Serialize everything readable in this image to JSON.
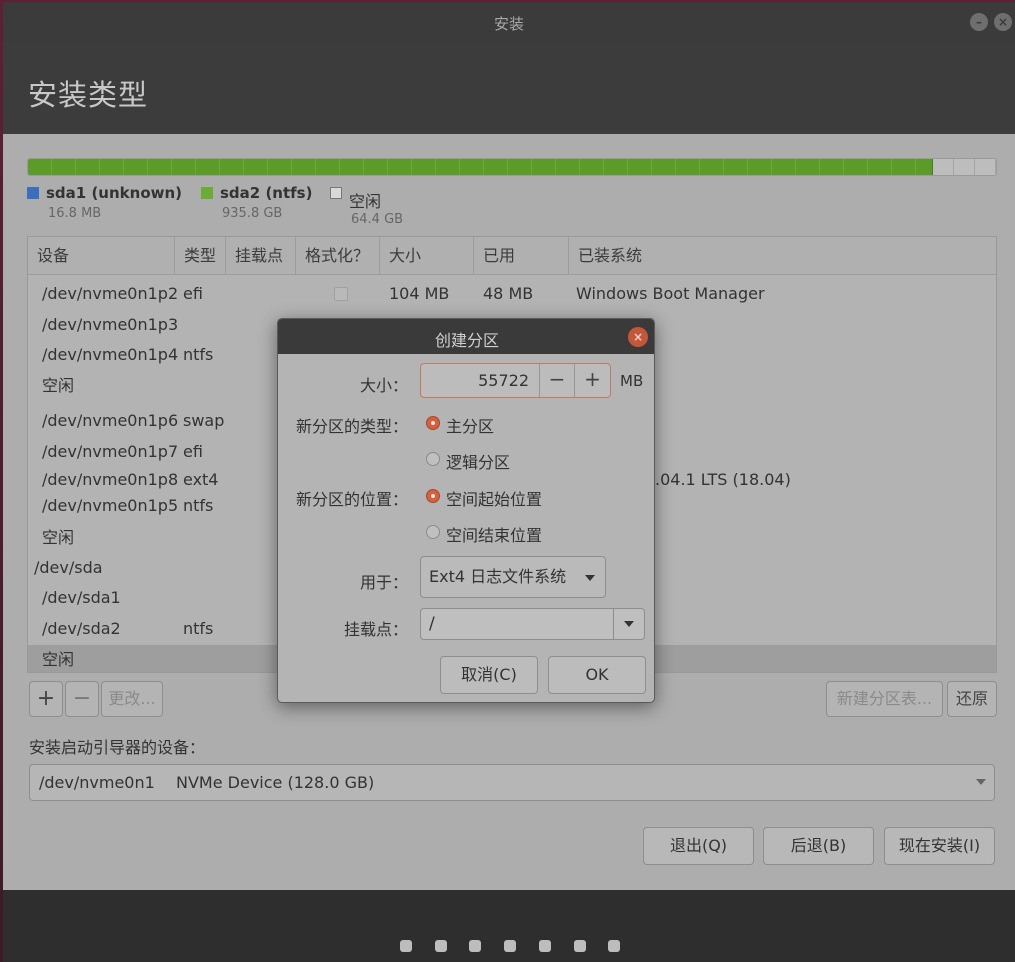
{
  "window": {
    "title": "安装"
  },
  "page": {
    "title": "安装类型"
  },
  "disk_bar": {
    "used_fraction": 0.935,
    "colors": {
      "sda1": "#3a6fc0",
      "sda2": "#6cab36",
      "free": "#bdbdbd"
    }
  },
  "legend": [
    {
      "name": "sda1 (unknown)",
      "size": "16.8 MB",
      "color": "#3a6fc0"
    },
    {
      "name": "sda2 (ntfs)",
      "size": "935.8 GB",
      "color": "#6cab36"
    },
    {
      "name": "空闲",
      "size": "64.4 GB",
      "color": "#d8d8d8"
    }
  ],
  "table": {
    "columns": [
      "设备",
      "类型",
      "挂载点",
      "格式化？",
      "大小",
      "已用",
      "已装系统"
    ],
    "rows": [
      {
        "device": "/dev/nvme0n1p2",
        "type": "efi",
        "size": "104 MB",
        "used": "48 MB",
        "system": "Windows Boot Manager",
        "checkbox": true
      },
      {
        "device": "/dev/nvme0n1p3",
        "type": ""
      },
      {
        "device": "/dev/nvme0n1p4",
        "type": "ntfs"
      },
      {
        "device": "空闲",
        "type": ""
      },
      {
        "device": "/dev/nvme0n1p6",
        "type": "swap"
      },
      {
        "device": "/dev/nvme0n1p7",
        "type": "efi"
      },
      {
        "device": "/dev/nvme0n1p8",
        "type": "ext4",
        "system": ".04.1 LTS (18.04)"
      },
      {
        "device": "/dev/nvme0n1p5",
        "type": "ntfs"
      },
      {
        "device": "空闲",
        "type": ""
      },
      {
        "device": "/dev/sda",
        "type": ""
      },
      {
        "device": "/dev/sda1",
        "type": ""
      },
      {
        "device": "/dev/sda2",
        "type": "ntfs"
      },
      {
        "device": "空闲",
        "type": "",
        "selected": true
      }
    ]
  },
  "table_buttons": {
    "add": "+",
    "remove": "−",
    "change": "更改...",
    "new_table": "新建分区表...",
    "revert": "还原"
  },
  "bootloader": {
    "label": "安装启动引导器的设备：",
    "device": "/dev/nvme0n1",
    "description": "NVMe Device (128.0 GB)"
  },
  "actions": {
    "quit": "退出(Q)",
    "back": "后退(B)",
    "install": "现在安装(I)"
  },
  "footer": {
    "step_count": 7
  },
  "dialog": {
    "title": "创建分区",
    "size_label": "大小：",
    "size_value": "55722",
    "size_unit": "MB",
    "minus": "−",
    "plus": "+",
    "type_label": "新分区的类型：",
    "type_options": [
      "主分区",
      "逻辑分区"
    ],
    "type_selected": "主分区",
    "location_label": "新分区的位置：",
    "location_options": [
      "空间起始位置",
      "空间结束位置"
    ],
    "location_selected": "空间起始位置",
    "use_label": "用于：",
    "use_value": "Ext4 日志文件系统",
    "mount_label": "挂载点：",
    "mount_value": "/",
    "cancel": "取消(C)",
    "ok": "OK"
  }
}
